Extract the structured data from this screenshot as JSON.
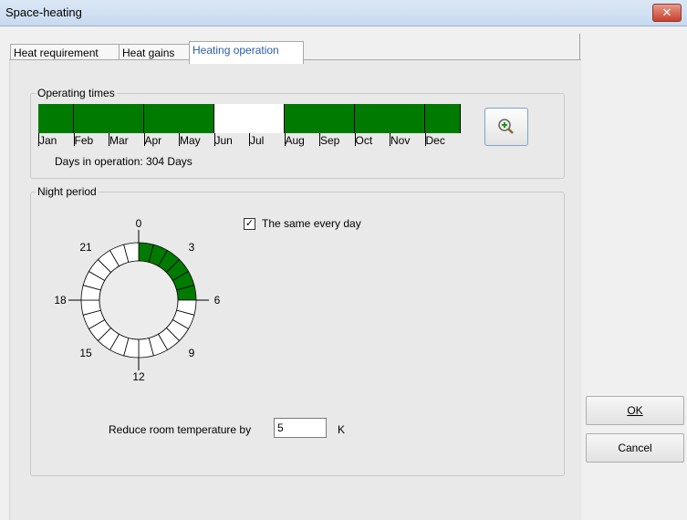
{
  "window": {
    "title": "Space-heating",
    "close_glyph": "✕"
  },
  "tabs": [
    {
      "label": "Heat requirement",
      "active": false
    },
    {
      "label": "Heat gains",
      "active": false
    },
    {
      "label": "Heating operation",
      "active": true
    }
  ],
  "operating_times": {
    "label": "Operating times",
    "months": [
      {
        "label": "Jan",
        "active": true
      },
      {
        "label": "Feb",
        "active": true
      },
      {
        "label": "Mar",
        "active": true
      },
      {
        "label": "Apr",
        "active": true
      },
      {
        "label": "May",
        "active": true
      },
      {
        "label": "Jun",
        "active": false
      },
      {
        "label": "Jul",
        "active": false
      },
      {
        "label": "Aug",
        "active": true
      },
      {
        "label": "Sep",
        "active": true
      },
      {
        "label": "Oct",
        "active": true
      },
      {
        "label": "Nov",
        "active": true
      },
      {
        "label": "Dec",
        "active": true
      }
    ],
    "days_text": "Days in operation: 304 Days",
    "zoom_icon": "zoom-in-icon"
  },
  "night_period": {
    "label": "Night period",
    "same_every_day_label": "The same every day",
    "same_every_day_checked": true,
    "check_glyph": "✓",
    "hour_labels": [
      "0",
      "3",
      "6",
      "9",
      "12",
      "15",
      "18",
      "21"
    ],
    "active_hours": [
      0,
      1,
      2,
      3,
      4,
      5
    ],
    "reduce_label": "Reduce room temperature by",
    "reduce_value": "5",
    "unit": "K"
  },
  "buttons": {
    "ok": "OK",
    "cancel": "Cancel"
  },
  "colors": {
    "active": "#007a00",
    "inactive": "#ffffff",
    "accent": "#2a5ea8"
  }
}
